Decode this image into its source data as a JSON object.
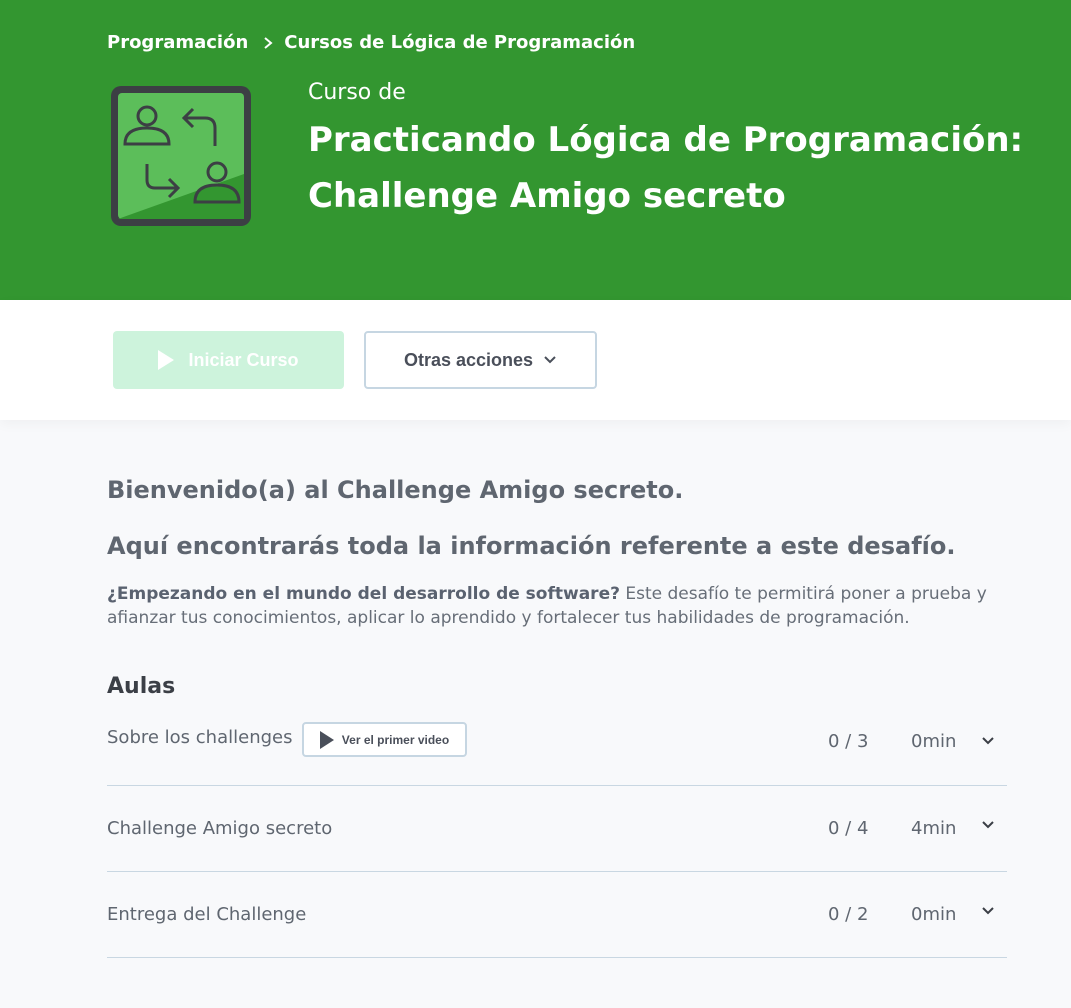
{
  "breadcrumb": {
    "items": [
      "Programación",
      "Cursos de Lógica de Programación"
    ]
  },
  "hero": {
    "subtitle": "Curso de",
    "title_line1": "Practicando Lógica de Programación:",
    "title_line2": "Challenge Amigo secreto"
  },
  "actions": {
    "start_label": "Iniciar Curso",
    "other_label": "Otras acciones"
  },
  "intro": {
    "welcome": "Bienvenido(a) al Challenge Amigo secreto.",
    "info": "Aquí encontrarás toda la información referente a este desafío.",
    "desc_bold": "¿Empezando en el mundo del desarrollo de software?",
    "desc_rest": " Este desafío te permitirá poner a prueba y afianzar tus conocimientos, aplicar lo aprendido y fortalecer tus habilidades de programación."
  },
  "aulas": {
    "title": "Aulas",
    "video_button_label": "Ver el primer video",
    "lessons": [
      {
        "name": "Sobre los challenges",
        "progress": "0 / 3",
        "duration": "0min"
      },
      {
        "name": "Challenge Amigo secreto",
        "progress": "0 / 4",
        "duration": "4min"
      },
      {
        "name": "Entrega del Challenge",
        "progress": "0 / 2",
        "duration": "0min"
      }
    ]
  },
  "colors": {
    "hero_bg": "#339630",
    "start_button_bg": "#cdf3dc",
    "icon_green": "#5cbe5a",
    "icon_dark": "#3c3f44"
  },
  "icons": {
    "course": "people-exchange-icon",
    "breadcrumb_sep": "chevron-right-icon",
    "play": "play-icon",
    "dropdown": "chevron-down-icon"
  }
}
